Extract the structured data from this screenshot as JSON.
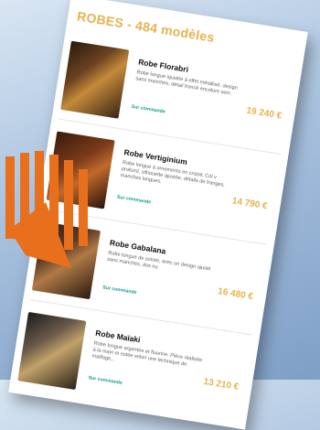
{
  "page": {
    "title": "ROBES - 484 modèles"
  },
  "products": [
    {
      "name": "Robe Florabri",
      "description": "Robe longue ajustée à effet métallisé, design sans manches, détail froncé encolure sein.",
      "availability": "Sur commande",
      "price": "19 240 €"
    },
    {
      "name": "Robe Vertiginium",
      "description": "Robe longue à ornements en cristal, Col v profond, silhouette ajustée, détails de franges, manches longues.",
      "availability": "Sur commande",
      "price": "14 790 €"
    },
    {
      "name": "Robe Gabalana",
      "description": "Robe longue de soirée, avec un design ajusté sans manches, dos nu.",
      "availability": "Sur commande",
      "price": "16 480 €"
    },
    {
      "name": "Robe Maïaki",
      "description": "Robe longue argentée et fluorine. Pièce réalisée à la main et notée selon une technique de maillage...",
      "availability": "Sur commande",
      "price": "13 210 €"
    }
  ]
}
